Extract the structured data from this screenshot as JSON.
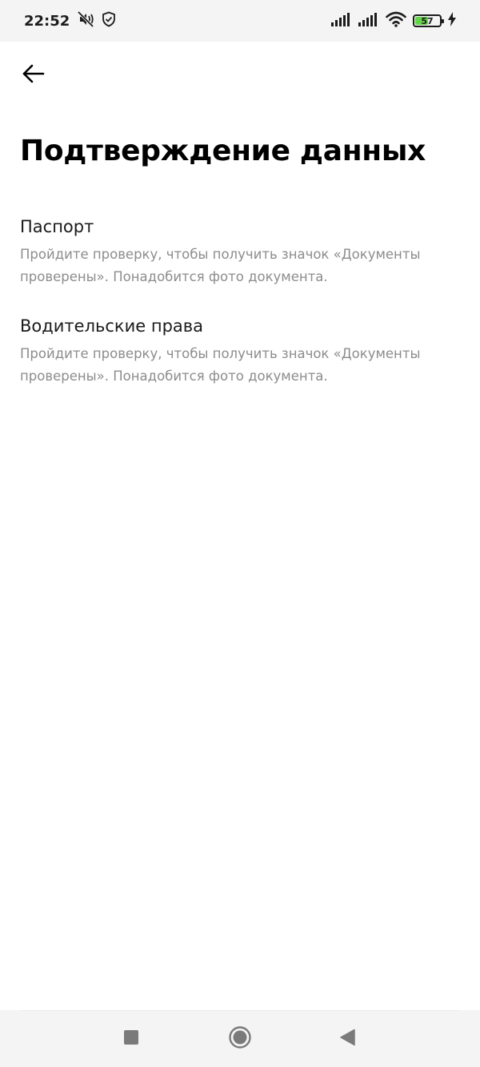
{
  "status_bar": {
    "time": "22:52",
    "battery_level": "57",
    "battery_fill_percent": 57,
    "battery_color": "#63d54a",
    "icons": [
      "mute-icon",
      "shield-icon",
      "signal-icon",
      "signal-icon",
      "wifi-icon",
      "battery-icon",
      "charging-icon"
    ]
  },
  "header": {
    "back_icon": "arrow-left-icon",
    "title": "Подтверждение данных"
  },
  "documents": [
    {
      "title": "Паспорт",
      "description": "Пройдите проверку, чтобы получить значок «Документы проверены». Понадобится фото документа."
    },
    {
      "title": "Водительские права",
      "description": "Пройдите проверку, чтобы получить значок «Документы проверены». Понадобится фото документа."
    }
  ],
  "nav_bar": {
    "icons": [
      "recents-square-icon",
      "home-circle-icon",
      "back-triangle-icon"
    ]
  }
}
